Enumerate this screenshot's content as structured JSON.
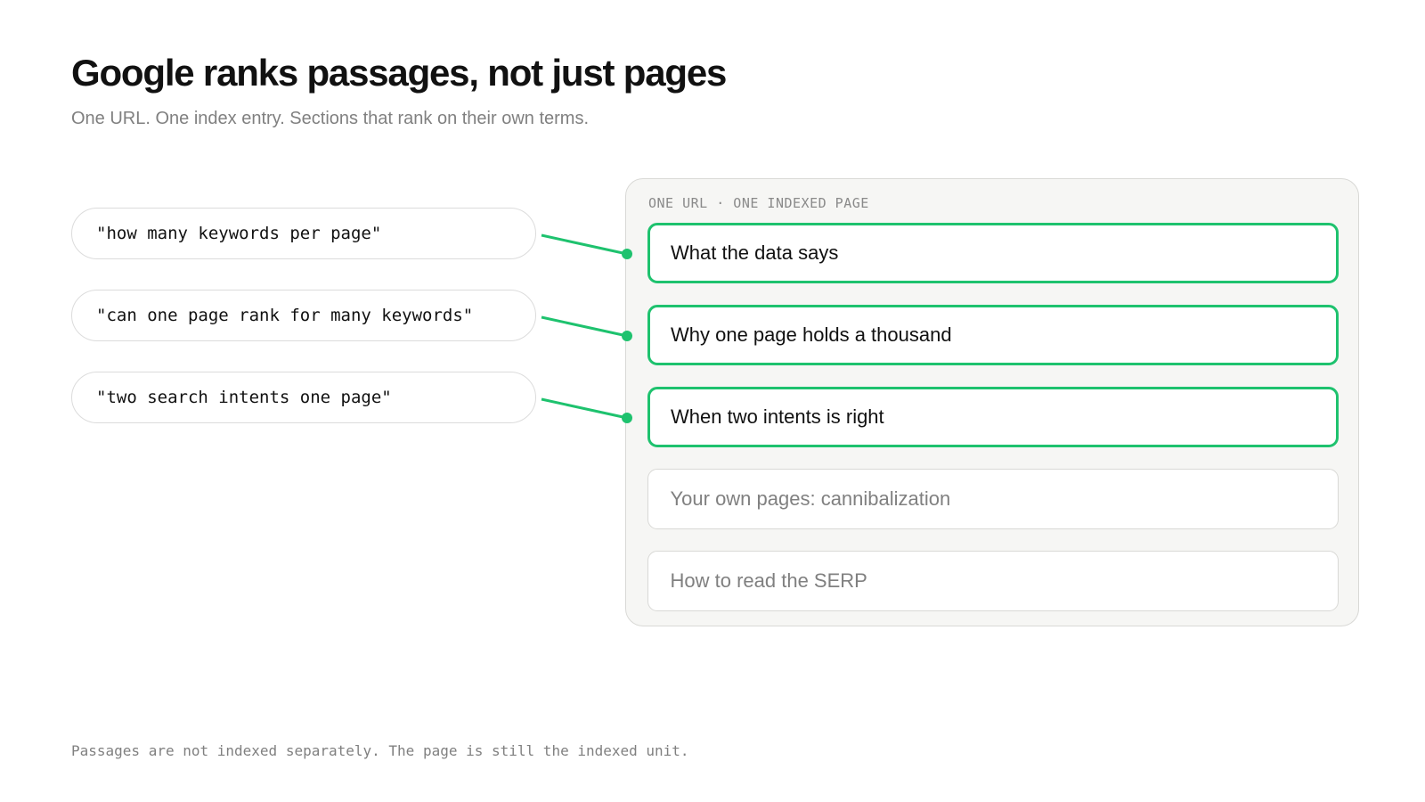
{
  "header": {
    "title": "Google ranks passages, not just pages",
    "subtitle": "One URL. One index entry. Sections that rank on their own terms."
  },
  "queries": [
    "\"how many keywords per page\"",
    "\"can one page rank for many keywords\"",
    "\"two search intents one page\""
  ],
  "page": {
    "label": "ONE URL · ONE INDEXED PAGE",
    "sections": [
      {
        "label": "What the data says",
        "state": "matched"
      },
      {
        "label": "Why one page holds a thousand",
        "state": "matched"
      },
      {
        "label": "When two intents is right",
        "state": "matched"
      },
      {
        "label": "Your own pages: cannibalization",
        "state": "unmatched"
      },
      {
        "label": "How to read the SERP",
        "state": "unmatched"
      }
    ]
  },
  "connections": [
    {
      "query": 0,
      "section": 0
    },
    {
      "query": 1,
      "section": 1
    },
    {
      "query": 2,
      "section": 2
    }
  ],
  "colors": {
    "accent": "#1ec26e",
    "muted_text": "#808080",
    "card_background": "#f6f6f4",
    "border": "#dcdcdc"
  },
  "footnote": "Passages are not indexed separately. The page is still the indexed unit."
}
